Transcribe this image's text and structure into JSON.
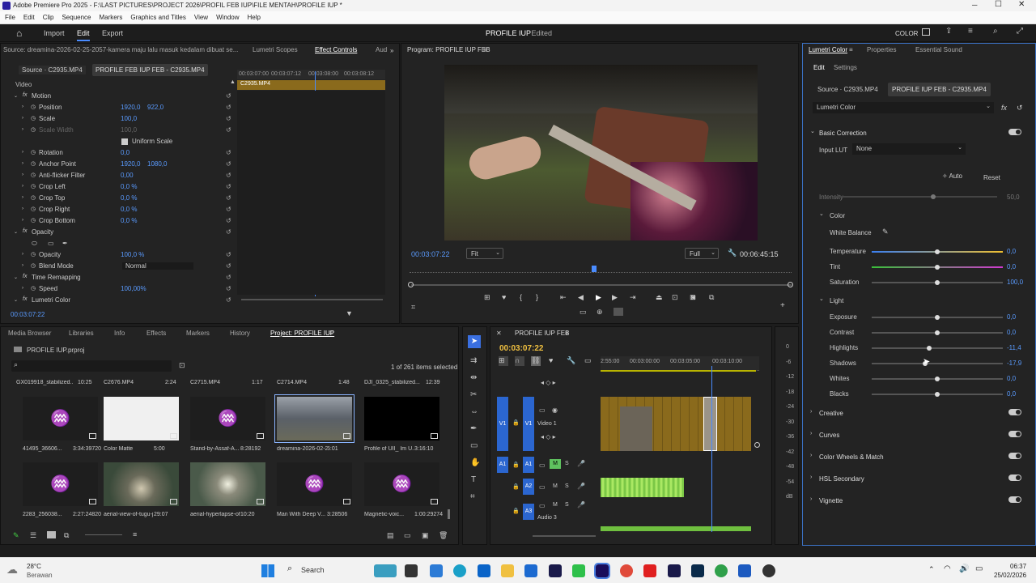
{
  "window": {
    "title": "Adobe Premiere Pro 2025 - F:\\LAST PICTURES\\PROJECT 2026\\PROFIL FEB IUP\\FILE MENTAH\\PROFILE IUP *"
  },
  "menu": [
    "File",
    "Edit",
    "Clip",
    "Sequence",
    "Markers",
    "Graphics and Titles",
    "View",
    "Window",
    "Help"
  ],
  "header": {
    "import": "Import",
    "edit": "Edit",
    "export": "Export",
    "project_title": "PROFILE IUP",
    "edited": "- Edited",
    "workspace": "COLOR"
  },
  "source_panel": {
    "tabs": [
      "Source: dreamina-2026-02-25-2057-kamera maju lalu masuk kedalam dibuat se...mp4",
      "Lumetri Scopes",
      "Effect Controls",
      "Aud"
    ],
    "clip_tabs": [
      "Source · C2935.MP4",
      "PROFILE FEB IUP FEB - C2935.MP4"
    ],
    "ruler": [
      "00:03:07:00",
      "00:03:07:12",
      "00:03:08:00",
      "00:03:08:12",
      "00:0"
    ],
    "clip_label": "C2935.MP4",
    "section_video": "Video",
    "rows": [
      {
        "label": "Motion",
        "v1": "",
        "v2": "",
        "indent": 1
      },
      {
        "label": "Position",
        "v1": "1920,0",
        "v2": "922,0",
        "indent": 2
      },
      {
        "label": "Scale",
        "v1": "100,0",
        "v2": "",
        "indent": 2
      },
      {
        "label": "Scale Width",
        "v1": "100,0",
        "v2": "",
        "indent": 2,
        "dim": true
      },
      {
        "label": "Uniform Scale",
        "v1": "",
        "v2": "",
        "indent": 3
      },
      {
        "label": "Rotation",
        "v1": "0,0",
        "v2": "",
        "indent": 2
      },
      {
        "label": "Anchor Point",
        "v1": "1920,0",
        "v2": "1080,0",
        "indent": 2
      },
      {
        "label": "Anti-flicker Filter",
        "v1": "0,00",
        "v2": "",
        "indent": 2
      },
      {
        "label": "Crop Left",
        "v1": "0,0 %",
        "v2": "",
        "indent": 2
      },
      {
        "label": "Crop Top",
        "v1": "0,0 %",
        "v2": "",
        "indent": 2
      },
      {
        "label": "Crop Right",
        "v1": "0,0 %",
        "v2": "",
        "indent": 2
      },
      {
        "label": "Crop Bottom",
        "v1": "0,0 %",
        "v2": "",
        "indent": 2
      },
      {
        "label": "Opacity",
        "v1": "",
        "v2": "",
        "indent": 1
      },
      {
        "label": "",
        "v1": "",
        "v2": "",
        "indent": 2
      },
      {
        "label": "Opacity",
        "v1": "100,0 %",
        "v2": "",
        "indent": 2
      },
      {
        "label": "Blend Mode",
        "v1": "Normal",
        "v2": "",
        "indent": 2
      },
      {
        "label": "Time Remapping",
        "v1": "",
        "v2": "",
        "indent": 1
      },
      {
        "label": "Speed",
        "v1": "100,00%",
        "v2": "",
        "indent": 2
      },
      {
        "label": "Lumetri Color",
        "v1": "",
        "v2": "",
        "indent": 1
      }
    ],
    "timecode": "00:03:07:22"
  },
  "program": {
    "tab": "Program: PROFILE IUP FEB",
    "timecode": "00:03:07:22",
    "fit": "Fit",
    "quality": "Full",
    "duration": "00:06:45:15"
  },
  "lumetri": {
    "tabs": [
      "Lumetri Color",
      "Properties",
      "Essential Sound"
    ],
    "subtabs": [
      "Edit",
      "Settings"
    ],
    "clip_tabs": [
      "Source · C2935.MP4",
      "PROFILE IUP FEB - C2935.MP4"
    ],
    "effect": "Lumetri Color",
    "basic": "Basic Correction",
    "input_lut_label": "Input LUT",
    "input_lut": "None",
    "auto": "Auto",
    "reset": "Reset",
    "intensity_label": "Intensity",
    "intensity_value": "50,0",
    "color_section": "Color",
    "white_balance": "White Balance",
    "color_sliders": [
      {
        "label": "Temperature",
        "value": "0,0",
        "pos": 0.5
      },
      {
        "label": "Tint",
        "value": "0,0",
        "pos": 0.5
      },
      {
        "label": "Saturation",
        "value": "100,0",
        "pos": 0.5
      }
    ],
    "light_section": "Light",
    "light_sliders": [
      {
        "label": "Exposure",
        "value": "0,0",
        "pos": 0.5
      },
      {
        "label": "Contrast",
        "value": "0,0",
        "pos": 0.5
      },
      {
        "label": "Highlights",
        "value": "-11,4",
        "pos": 0.44
      },
      {
        "label": "Shadows",
        "value": "-17,9",
        "pos": 0.41
      },
      {
        "label": "Whites",
        "value": "0,0",
        "pos": 0.5
      },
      {
        "label": "Blacks",
        "value": "0,0",
        "pos": 0.5
      }
    ],
    "sections": [
      "Creative",
      "Curves",
      "Color Wheels & Match",
      "HSL Secondary",
      "Vignette"
    ]
  },
  "project": {
    "tabs": [
      "Media Browser",
      "Libraries",
      "Info",
      "Effects",
      "Markers",
      "History",
      "Project: PROFILE IUP"
    ],
    "file": "PROFILE IUP.prproj",
    "selection": "1 of 261 items selected",
    "top_names": [
      {
        "name": "GX019918_stabilized...",
        "dur": "10:25"
      },
      {
        "name": "C2676.MP4",
        "dur": "2:24"
      },
      {
        "name": "C2715.MP4",
        "dur": "1:17"
      },
      {
        "name": "C2714.MP4",
        "dur": "1:48"
      },
      {
        "name": "DJI_0325_stabilized...",
        "dur": "12:39"
      }
    ],
    "row1": [
      {
        "name": "41495_36606...",
        "dur": "3:34:39720"
      },
      {
        "name": "Color Matte",
        "dur": "5:00"
      },
      {
        "name": "Stand-by-Assaf-A...",
        "dur": "8:28192"
      },
      {
        "name": "dreamina-2026-02-25...",
        "dur": "5:01"
      },
      {
        "name": "Profile of UII_ Im U...",
        "dur": "3:16:10"
      }
    ],
    "row2": [
      {
        "name": "2283_256038...",
        "dur": "2:27:24820"
      },
      {
        "name": "aerial-view-of-tugu-j...",
        "dur": "29:07"
      },
      {
        "name": "aerial-hyperlapse-of...",
        "dur": "10:20"
      },
      {
        "name": "Man With Deep V...",
        "dur": "3:28506"
      },
      {
        "name": "Magnetic-voic...",
        "dur": "1:00:29274"
      }
    ]
  },
  "timeline": {
    "tab": "PROFILE IUP FEB",
    "timecode": "00:03:07:22",
    "ruler": [
      "2:55:00",
      "00:03:00:00",
      "00:03:05:00",
      "00:03:10:00"
    ],
    "tracks": [
      {
        "id": "V1",
        "name": "Video 1"
      },
      {
        "id": "A1",
        "name": ""
      },
      {
        "id": "A2",
        "name": ""
      },
      {
        "id": "A3",
        "name": "Audio 3"
      }
    ],
    "meter": [
      "0",
      "-6",
      "-12",
      "-18",
      "-24",
      "-30",
      "-36",
      "-42",
      "-48",
      "-54",
      "dB"
    ]
  },
  "taskbar": {
    "temp": "28°C",
    "weather": "Berawan",
    "search": "Search",
    "time": "06:37",
    "date": "25/02/2026"
  }
}
